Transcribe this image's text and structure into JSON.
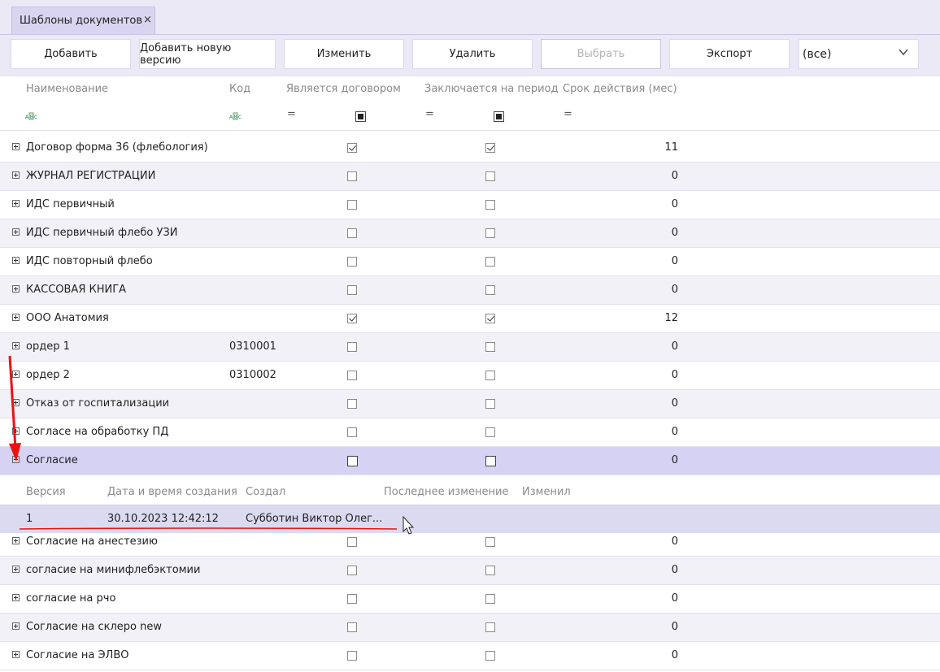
{
  "tab": {
    "title": "Шаблоны документов",
    "close": "×"
  },
  "toolbar": {
    "add": "Добавить",
    "add_version": "Добавить новую версию",
    "edit": "Изменить",
    "delete": "Удалить",
    "select": "Выбрать",
    "export": "Экспорт",
    "filter_value": "(все)"
  },
  "columns": {
    "name": "Наименование",
    "code": "Код",
    "is_contract": "Является договором",
    "for_period": "Заключается на период",
    "validity": "Срок действия (мес)"
  },
  "filter": {
    "text_icon": "abc-filter-icon",
    "eq": "="
  },
  "rows": [
    {
      "name": "Договор форма 36 (флебология)",
      "code": "",
      "contract": true,
      "period": true,
      "months": "11"
    },
    {
      "name": "ЖУРНАЛ РЕГИСТРАЦИИ",
      "code": "",
      "contract": false,
      "period": false,
      "months": "0"
    },
    {
      "name": "ИДС первичный",
      "code": "",
      "contract": false,
      "period": false,
      "months": "0"
    },
    {
      "name": "ИДС первичный флебо УЗИ",
      "code": "",
      "contract": false,
      "period": false,
      "months": "0"
    },
    {
      "name": "ИДС повторный флебо",
      "code": "",
      "contract": false,
      "period": false,
      "months": "0"
    },
    {
      "name": "КАССОВАЯ КНИГА",
      "code": "",
      "contract": false,
      "period": false,
      "months": "0"
    },
    {
      "name": "ООО Анатомия",
      "code": "",
      "contract": true,
      "period": true,
      "months": "12"
    },
    {
      "name": "ордер 1",
      "code": "0310001",
      "contract": false,
      "period": false,
      "months": "0"
    },
    {
      "name": "ордер 2",
      "code": "0310002",
      "contract": false,
      "period": false,
      "months": "0"
    },
    {
      "name": "Отказ от госпитализации",
      "code": "",
      "contract": false,
      "period": false,
      "months": "0"
    },
    {
      "name": "Согласе на обработку ПД",
      "code": "",
      "contract": false,
      "period": false,
      "months": "0"
    },
    {
      "name": "Согласие",
      "code": "",
      "contract": false,
      "period": false,
      "months": "0"
    },
    {
      "name": "Согласие на анестезию",
      "code": "",
      "contract": false,
      "period": false,
      "months": "0"
    },
    {
      "name": "согласие на минифлебэктомии",
      "code": "",
      "contract": false,
      "period": false,
      "months": "0"
    },
    {
      "name": "согласие на рчо",
      "code": "",
      "contract": false,
      "period": false,
      "months": "0"
    },
    {
      "name": "Согласие на склеро new",
      "code": "",
      "contract": false,
      "period": false,
      "months": "0"
    },
    {
      "name": "Согласие на ЭЛВО",
      "code": "",
      "contract": false,
      "period": false,
      "months": "0"
    }
  ],
  "detail": {
    "columns": {
      "version": "Версия",
      "created_at": "Дата и время создания",
      "created_by": "Создал",
      "last_change": "Последнее изменение",
      "changed_by": "Изменил"
    },
    "row": {
      "version": "1",
      "created_at": "30.10.2023 12:42:12",
      "created_by": "Субботин Виктор Олег..."
    }
  },
  "colors": {
    "accent": "#d6d2f4",
    "annotation": "#e8140f"
  }
}
